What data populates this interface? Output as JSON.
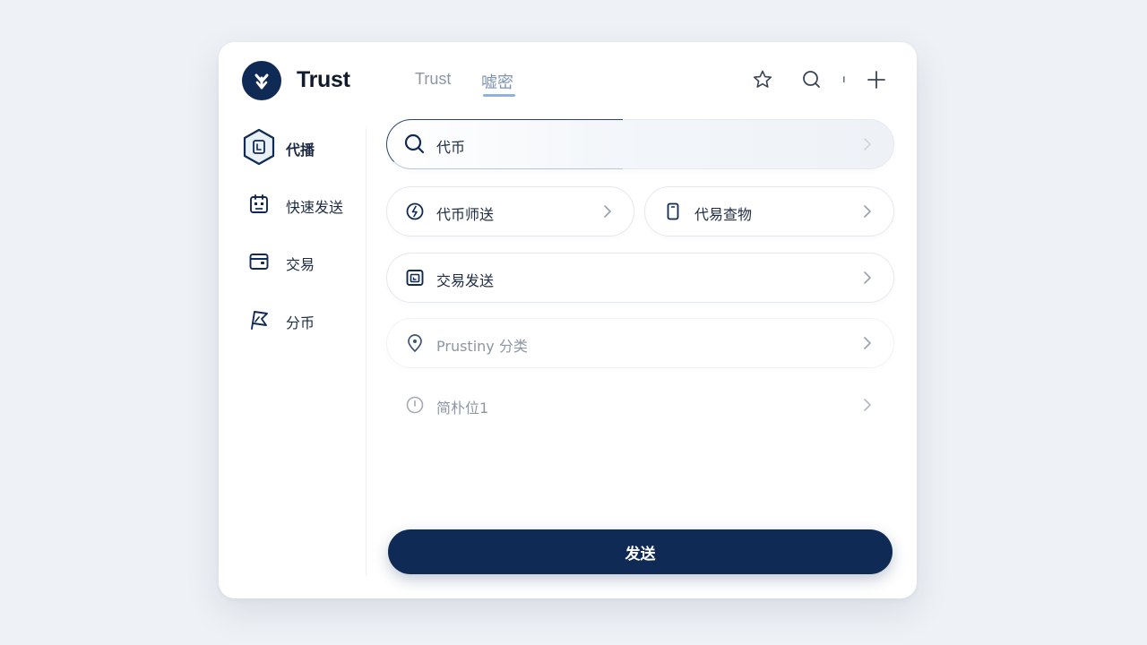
{
  "header": {
    "brand": "Trust",
    "tabs": [
      {
        "label": "Trust"
      },
      {
        "label": "嘘密"
      }
    ]
  },
  "sidebar": {
    "items": [
      {
        "label": "代播",
        "icon": "hexagon-badge-icon",
        "active": true
      },
      {
        "label": "快速发送",
        "icon": "calendar-robot-icon"
      },
      {
        "label": "交易",
        "icon": "wallet-icon"
      },
      {
        "label": "分币",
        "icon": "flag-icon"
      }
    ]
  },
  "main": {
    "search": {
      "value": "代币",
      "icon": "search-icon"
    },
    "rows": [
      {
        "label": "代币师送",
        "icon": "bolt-circle-icon"
      },
      {
        "label": "代易查物",
        "icon": "phone-icon"
      },
      {
        "label": "交易发送",
        "icon": "wallet-box-icon"
      },
      {
        "label": "Prustiny 分类",
        "icon": "location-pin-icon"
      },
      {
        "label": "简朴位1",
        "icon": "info-circle-icon"
      }
    ],
    "send_button": "发送"
  },
  "colors": {
    "brand_navy": "#102a56",
    "background": "#eef1f5",
    "card": "#ffffff",
    "tab_accent": "#8fb0e0"
  }
}
